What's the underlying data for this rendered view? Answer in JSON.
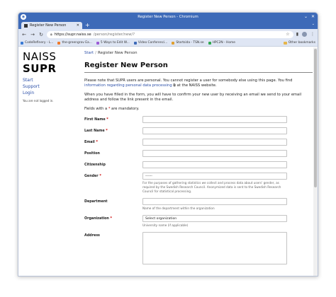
{
  "window": {
    "title": "Register New Person - Chromium"
  },
  "tab": {
    "title": "Register New Person"
  },
  "omnibox": {
    "host": "https://supr.naiss.se",
    "path": "/person/register/new/?"
  },
  "bookmarks": [
    {
      "label": "CodeRefinery - L...",
      "color": "#3a7bd5"
    },
    {
      "label": "the-greengrav Ea...",
      "color": "#f07a2a"
    },
    {
      "label": "5 Ways to Edit W...",
      "color": "#9c5bd6"
    },
    {
      "label": "Video Conferenci...",
      "color": "#3d6ab8"
    },
    {
      "label": "Startsida - TSN.se",
      "color": "#e0a030"
    },
    {
      "label": "HPC2N - Home",
      "color": "#2fa84f"
    }
  ],
  "bookmarks_other": "Other bookmarks",
  "logo": {
    "line1": "NAISS",
    "line2": "SUPR"
  },
  "sidebar": {
    "links": [
      "Start",
      "Support",
      "Login"
    ],
    "note": "You are not logged in."
  },
  "breadcrumb": {
    "home": "Start",
    "sep": "/",
    "current": "Register New Person"
  },
  "page_title": "Register New Person",
  "intro": {
    "p1_before": "Please note that SUPR users are personal. You cannot register a user for somebody else using this page. You find ",
    "p1_link": "information regarding personal data processing",
    "p1_after": " at the NAISS website.",
    "p2": "When you have filled in the form, you will have to confirm your new user by receiving an email we send to your email address and follow the link present in the email.",
    "p3_before": "Fields with a ",
    "p3_star": "*",
    "p3_after": " are mandatory."
  },
  "form": {
    "first_name": {
      "label": "First Name",
      "star": "*"
    },
    "last_name": {
      "label": "Last Name",
      "star": "*"
    },
    "email": {
      "label": "Email",
      "star": "*"
    },
    "position": {
      "label": "Position"
    },
    "citizenship": {
      "label": "Citizenship"
    },
    "gender": {
      "label": "Gender",
      "star": "*",
      "value": "------",
      "help": "For the purposes of gathering statistics we collect and process data about users' gender, as required by the Swedish Research Council. Anonymized data is sent to the Swedish Research Council for statistical processing."
    },
    "department": {
      "label": "Department",
      "help": "Name of the department within the organization"
    },
    "organization": {
      "label": "Organization",
      "star": "*",
      "value": "Select organization",
      "help": "University name (if applicable)"
    },
    "address": {
      "label": "Address"
    }
  }
}
